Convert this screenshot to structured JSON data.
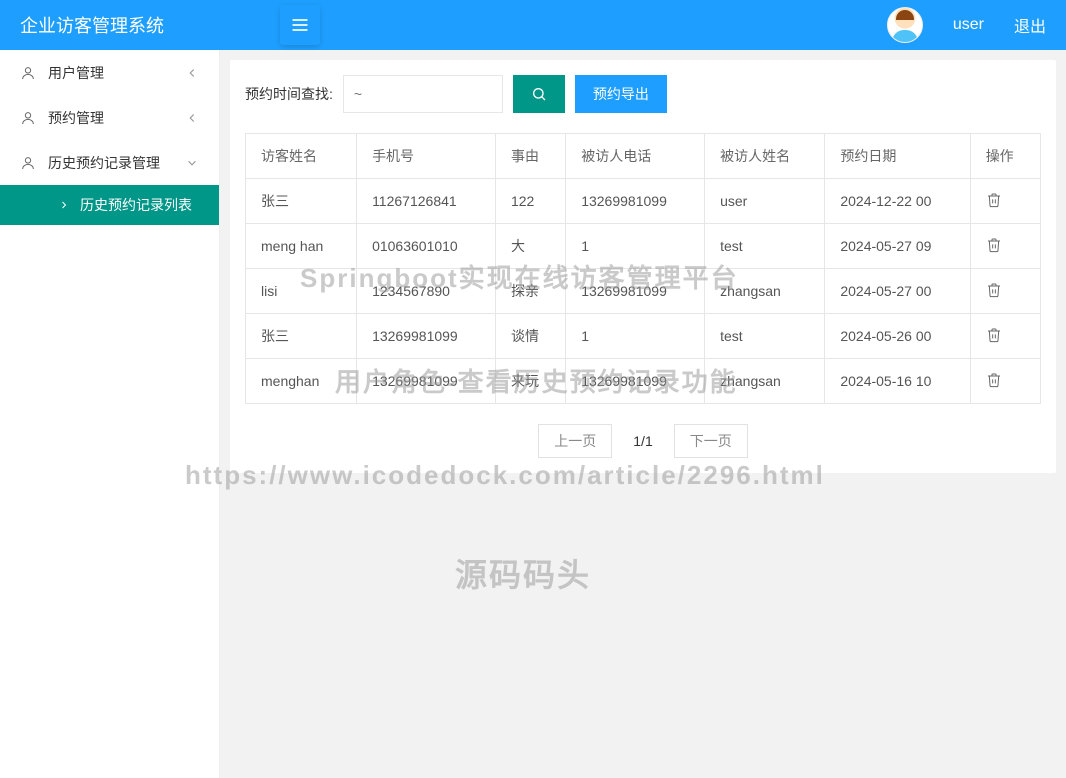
{
  "header": {
    "title": "企业访客管理系统",
    "username": "user",
    "logout": "退出"
  },
  "sidebar": {
    "items": [
      {
        "label": "用户管理",
        "expanded": false
      },
      {
        "label": "预约管理",
        "expanded": false
      },
      {
        "label": "历史预约记录管理",
        "expanded": true
      }
    ],
    "sub_item": "历史预约记录列表"
  },
  "search": {
    "label": "预约时间查找:",
    "placeholder": "~",
    "export_label": "预约导出"
  },
  "table": {
    "headers": [
      "访客姓名",
      "手机号",
      "事由",
      "被访人电话",
      "被访人姓名",
      "预约日期",
      "操作"
    ],
    "rows": [
      {
        "name": "张三",
        "phone": "11267126841",
        "reason": "122",
        "visitee_phone": "13269981099",
        "visitee_name": "user",
        "date": "2024-12-22 00"
      },
      {
        "name": "meng han",
        "phone": "01063601010",
        "reason": "大",
        "visitee_phone": "1",
        "visitee_name": "test",
        "date": "2024-05-27 09"
      },
      {
        "name": "lisi",
        "phone": "1234567890",
        "reason": "探亲",
        "visitee_phone": "13269981099",
        "visitee_name": "zhangsan",
        "date": "2024-05-27 00"
      },
      {
        "name": "张三",
        "phone": "13269981099",
        "reason": "谈情",
        "visitee_phone": "1",
        "visitee_name": "test",
        "date": "2024-05-26 00"
      },
      {
        "name": "menghan",
        "phone": "13269981099",
        "reason": "来玩",
        "visitee_phone": "13269981099",
        "visitee_name": "zhangsan",
        "date": "2024-05-16 10"
      }
    ]
  },
  "pagination": {
    "prev": "上一页",
    "info": "1/1",
    "next": "下一页"
  },
  "watermarks": {
    "w1": "Springboot实现在线访客管理平台",
    "w2": "用户角色-查看历史预约记录功能",
    "w3": "https://www.icodedock.com/article/2296.html",
    "w4": "源码码头"
  }
}
